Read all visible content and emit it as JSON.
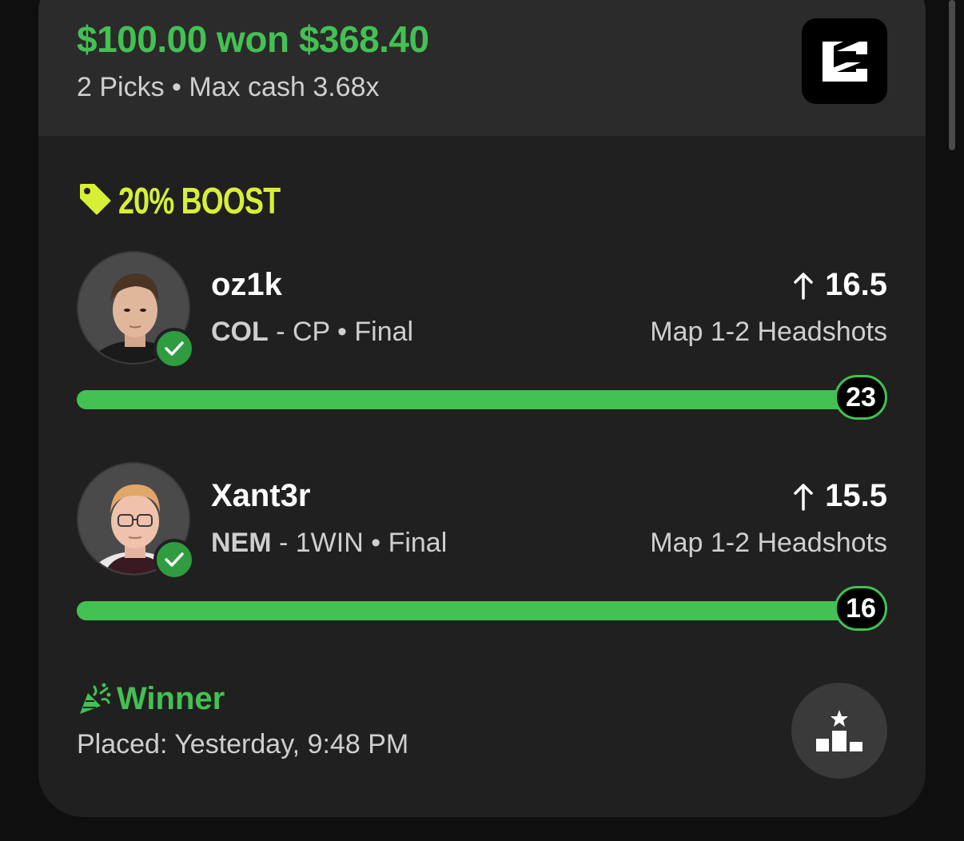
{
  "entry": {
    "title": "$100.00 won $368.40",
    "subtitle": "2 Picks • Max cash 3.68x"
  },
  "boost": {
    "label": "20% BOOST"
  },
  "picks": [
    {
      "player": "oz1k",
      "team": "COL",
      "matchup": " - CP • Final",
      "direction_icon": "arrow-up-icon",
      "line": "16.5",
      "stat": "Map 1-2 Headshots",
      "result": "23",
      "progress": 1.0
    },
    {
      "player": "Xant3r",
      "team": "NEM",
      "matchup": " - 1WIN • Final",
      "direction_icon": "arrow-up-icon",
      "line": "15.5",
      "stat": "Map 1-2 Headshots",
      "result": "16",
      "progress": 1.0
    }
  ],
  "footer": {
    "status": "Winner",
    "placed": "Placed: Yesterday, 9:48 PM"
  },
  "colors": {
    "accent_green": "#43c152",
    "boost_yellow": "#d7f035",
    "card_bg": "#202020",
    "header_bg": "#2b2b2b"
  }
}
